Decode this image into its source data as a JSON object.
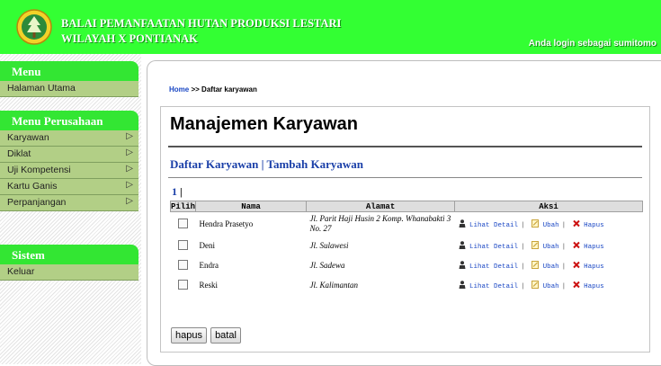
{
  "header": {
    "org_line1": "BALAI PEMANFAATAN HUTAN PRODUKSI LESTARI",
    "org_line2": "WILAYAH X PONTIANAK",
    "login_text": "Anda login sebagai sumitomo",
    "brand_color": "#33ff33"
  },
  "sidebar": {
    "menu_title": "Menu",
    "menu_items": [
      {
        "label": "Halaman Utama"
      }
    ],
    "perusahaan_title": "Menu Perusahaan",
    "perusahaan_items": [
      {
        "label": "Karyawan"
      },
      {
        "label": "Diklat"
      },
      {
        "label": "Uji Kompetensi"
      },
      {
        "label": "Kartu Ganis"
      },
      {
        "label": "Perpanjangan"
      }
    ],
    "sistem_title": "Sistem",
    "sistem_items": [
      {
        "label": "Keluar"
      }
    ]
  },
  "breadcrumb": {
    "home": "Home",
    "sep": ">>",
    "current": "Daftar karyawan"
  },
  "main": {
    "title": "Manajemen Karyawan",
    "nav_daftar": "Daftar Karyawan",
    "nav_sep": "|",
    "nav_tambah": "Tambah Karyawan",
    "page_number": "1",
    "page_bar": "|"
  },
  "table": {
    "headers": {
      "pilih": "Pilih",
      "nama": "Nama",
      "alamat": "Alamat",
      "aksi": "Aksi"
    },
    "rows": [
      {
        "nama": "Hendra Prasetyo",
        "alamat": "Jl. Parit Haji Husin 2 Komp. Whanabakti 3 No. 27"
      },
      {
        "nama": "Deni",
        "alamat": "Jl. Sulawesi"
      },
      {
        "nama": "Endra",
        "alamat": "Jl. Sadewa"
      },
      {
        "nama": "Reski",
        "alamat": "Jl. Kalimantan"
      }
    ],
    "action_detail": "Lihat Detail",
    "action_edit": "Ubah",
    "action_delete": "Hapus",
    "action_sep": "|"
  },
  "buttons": {
    "hapus": "hapus",
    "batal": "batal"
  }
}
